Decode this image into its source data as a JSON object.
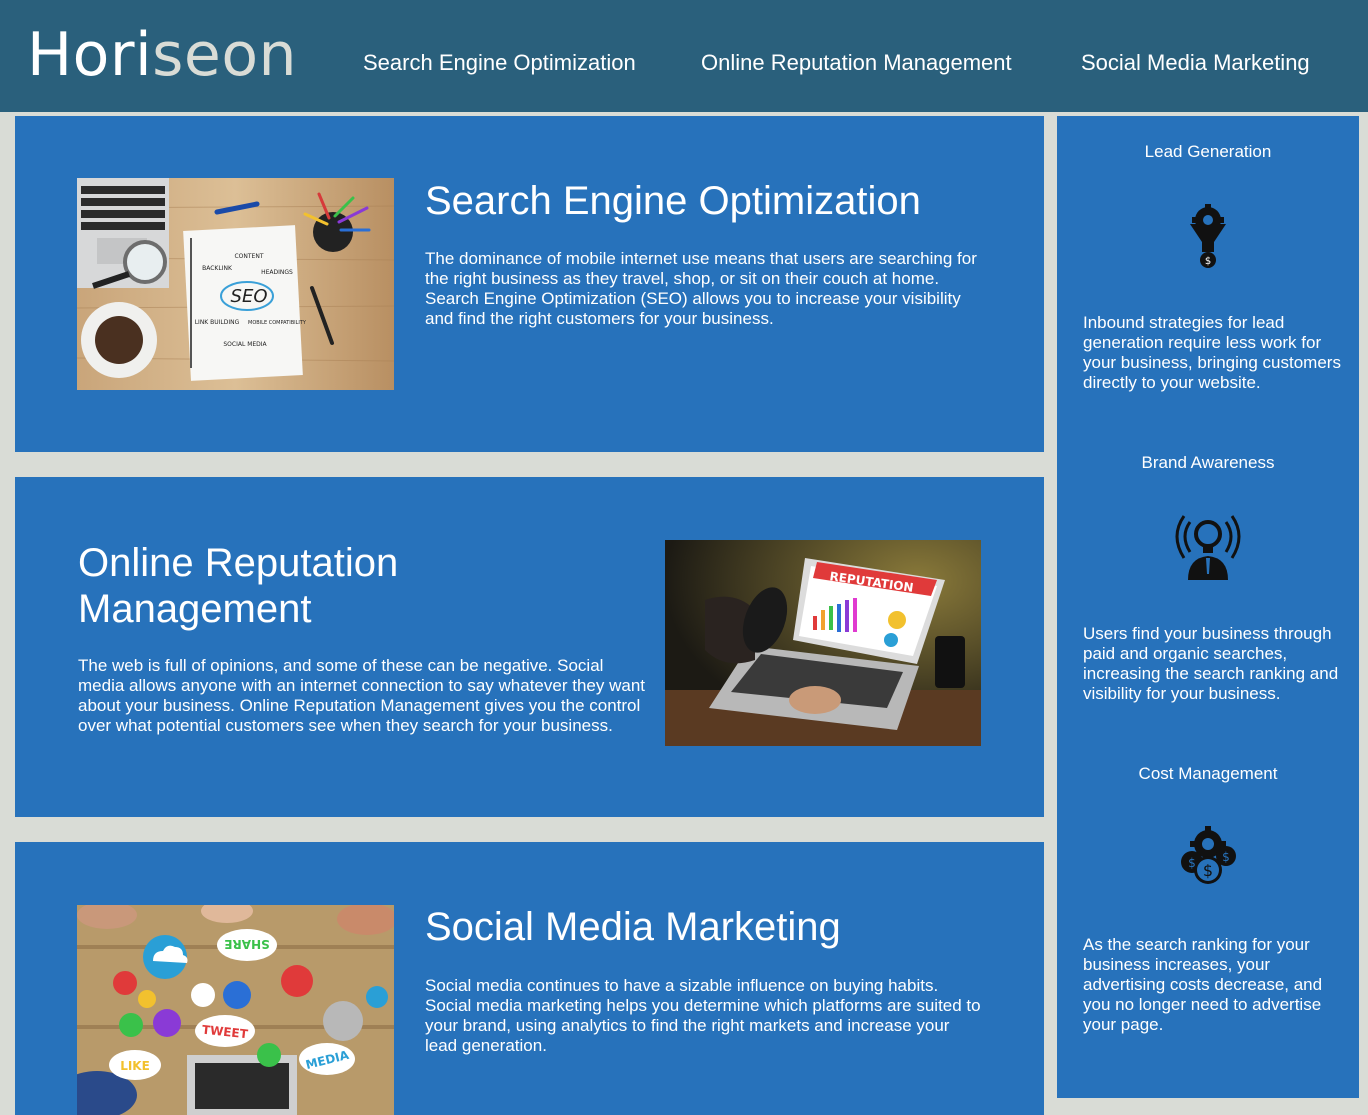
{
  "header": {
    "logo_main": "Hori",
    "logo_accent": "seon",
    "nav": [
      {
        "label": "Search Engine Optimization"
      },
      {
        "label": "Online Reputation Management"
      },
      {
        "label": "Social Media Marketing"
      }
    ]
  },
  "content": {
    "sections": [
      {
        "title": "Search Engine Optimization",
        "text": "The dominance of mobile internet use means that users are searching for the right business as they travel, shop, or sit on their couch at home. Search Engine Optimization (SEO) allows you to increase your visibility and find the right customers for your business.",
        "image_labels": {
          "center": "SEO",
          "a": "CONTENT",
          "b": "BACKLINK",
          "c": "HEADINGS",
          "d": "LINK BUILDING",
          "e": "MOBILE COMPATIBILITY",
          "f": "SOCIAL MEDIA"
        }
      },
      {
        "title": "Online Reputation Management",
        "text": "The web is full of opinions, and some of these can be negative. Social media allows anyone with an internet connection to say whatever they want about your business. Online Reputation Management gives you the control over what potential customers see when they search for your business.",
        "image_labels": {
          "banner": "REPUTATION"
        }
      },
      {
        "title": "Social Media Marketing",
        "text": "Social media continues to have a sizable influence on buying habits. Social media marketing helps you determine which platforms are suited to your brand, using analytics to find the right markets and increase your lead generation.",
        "image_labels": {
          "share": "SHARE",
          "tweet": "TWEET",
          "like": "LIKE",
          "media": "MEDIA"
        }
      }
    ]
  },
  "benefits": [
    {
      "title": "Lead Generation",
      "icon": "lead-funnel-icon",
      "text": "Inbound strategies for lead generation require less work for your business, bringing customers directly to your website."
    },
    {
      "title": "Brand Awareness",
      "icon": "lightbulb-broadcast-icon",
      "text": "Users find your business through paid and organic searches, increasing the search ranking and visibility for your business."
    },
    {
      "title": "Cost Management",
      "icon": "money-gear-icon",
      "text": "As the search ranking for your business increases, your advertising costs decrease, and you no longer need to advertise your page."
    }
  ],
  "colors": {
    "header": "#2a607c",
    "card": "#2772bb",
    "background": "#d9dcd6",
    "logo_accent": "#d9dcd6"
  }
}
